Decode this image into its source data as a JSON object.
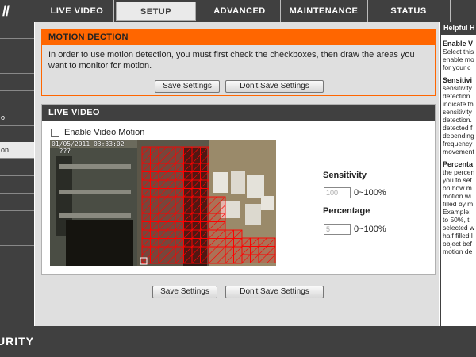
{
  "brand": {
    "logo_fragment": "//",
    "footer_text": "URITY"
  },
  "nav": {
    "tabs": [
      {
        "label": "LIVE VIDEO"
      },
      {
        "label": "SETUP"
      },
      {
        "label": "ADVANCED"
      },
      {
        "label": "MAINTENANCE"
      },
      {
        "label": "STATUS"
      }
    ],
    "active": "SETUP"
  },
  "sidebar": {
    "items": [
      {
        "label": ""
      },
      {
        "label": ""
      },
      {
        "label": ""
      },
      {
        "label": ""
      },
      {
        "label": "o"
      },
      {
        "label": ""
      },
      {
        "label": "on"
      },
      {
        "label": ""
      },
      {
        "label": ""
      },
      {
        "label": ""
      },
      {
        "label": ""
      },
      {
        "label": ""
      }
    ]
  },
  "motion": {
    "title": "MOTION DECTION",
    "description": "In order to use motion detection, you must first check the checkboxes, then draw the areas you want to monitor for motion.",
    "save_label": "Save Settings",
    "dont_save_label": "Don't Save Settings"
  },
  "live": {
    "title": "LIVE VIDEO",
    "enable_label": "Enable Video Motion",
    "enable_checked": false,
    "osd_line1": "01/05/2011 03:33:02",
    "osd_line2": "  ???",
    "sensitivity_label": "Sensitivity",
    "sensitivity_value": "100",
    "sensitivity_range": "0~100%",
    "percentage_label": "Percentage",
    "percentage_value": "5",
    "percentage_range": "0~100%"
  },
  "bottom": {
    "save_label": "Save Settings",
    "dont_save_label": "Don't Save Settings"
  },
  "help": {
    "title": "Helpful H",
    "sections": [
      {
        "heading": "Enable V",
        "lines": [
          "Select this",
          "enable mo",
          "for your c"
        ]
      },
      {
        "heading": "Sensitivi",
        "lines": [
          "sensitivity",
          "detection.",
          "indicate th",
          "sensitivity",
          "detection.",
          "detected f",
          "depending",
          "frequency",
          "movement"
        ]
      },
      {
        "heading": "Percenta",
        "lines": [
          "the percen",
          "you to set",
          "on how m",
          "motion wi",
          "filled by m",
          "Example:",
          "to 50%, t",
          "selected w",
          "half filled l",
          "object bef",
          "motion de"
        ]
      }
    ]
  },
  "colors": {
    "accent": "#ff6600",
    "dark": "#404040",
    "grid": "#ff0000"
  }
}
